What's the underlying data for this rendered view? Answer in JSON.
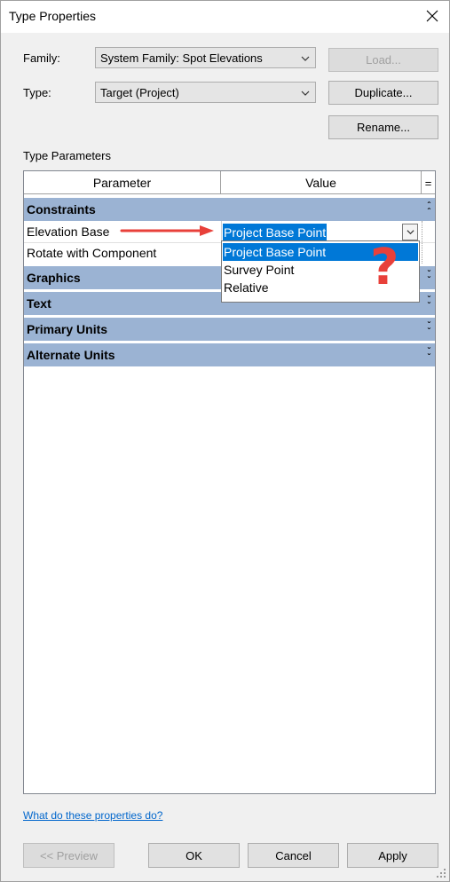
{
  "window": {
    "title": "Type Properties"
  },
  "family": {
    "label": "Family:",
    "value": "System Family: Spot Elevations"
  },
  "type": {
    "label": "Type:",
    "value": "Target (Project)"
  },
  "buttons": {
    "load": "Load...",
    "duplicate": "Duplicate...",
    "rename": "Rename..."
  },
  "type_parameters": {
    "label": "Type Parameters",
    "columns": {
      "parameter": "Parameter",
      "value": "Value",
      "toggle": "="
    },
    "categories": {
      "constraints": "Constraints",
      "graphics": "Graphics",
      "text": "Text",
      "primary_units": "Primary Units",
      "alternate_units": "Alternate Units"
    },
    "rows": {
      "elevation_base": {
        "name": "Elevation Base",
        "value": "Project Base Point"
      },
      "rotate_with_component": {
        "name": "Rotate with Component"
      }
    },
    "dropdown_options": [
      "Project Base Point",
      "Survey Point",
      "Relative"
    ]
  },
  "annotation": {
    "question_mark": "?",
    "arrow_color": "#e8403a"
  },
  "help_link": "What do these properties do?",
  "footer": {
    "preview": "<< Preview",
    "ok": "OK",
    "cancel": "Cancel",
    "apply": "Apply"
  },
  "colors": {
    "category_band": "#9bb3d3",
    "selection": "#0078d7",
    "annotation_red": "#e8403a"
  }
}
